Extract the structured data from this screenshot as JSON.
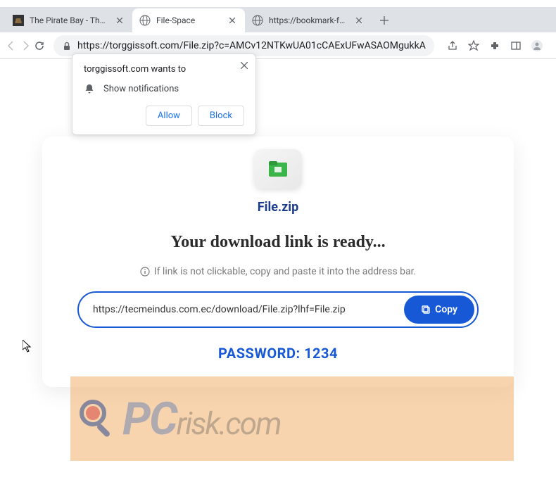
{
  "tabs": [
    {
      "title": "The Pirate Bay - The galaxy's",
      "active": false
    },
    {
      "title": "File-Space",
      "active": true
    },
    {
      "title": "https://bookmark-folders.com",
      "active": false
    }
  ],
  "url": "https://torggissoft.com/File.zip?c=AMCv12NTKwUA01cCAExUFwASAOMgukkA",
  "notification": {
    "title": "torggissoft.com wants to",
    "permission": "Show notifications",
    "allow": "Allow",
    "block": "Block"
  },
  "page": {
    "filename": "File.zip",
    "ready": "Your download link is ready...",
    "info": "If link is not clickable, copy and paste it into the address bar.",
    "download_url": "https://tecmeindus.com.ec/download/File.zip?lhf=File.zip",
    "copy_label": "Copy",
    "password_label": "PASSWORD: 1234"
  },
  "watermark": {
    "pc": "PC",
    "rest": "risk.com"
  }
}
